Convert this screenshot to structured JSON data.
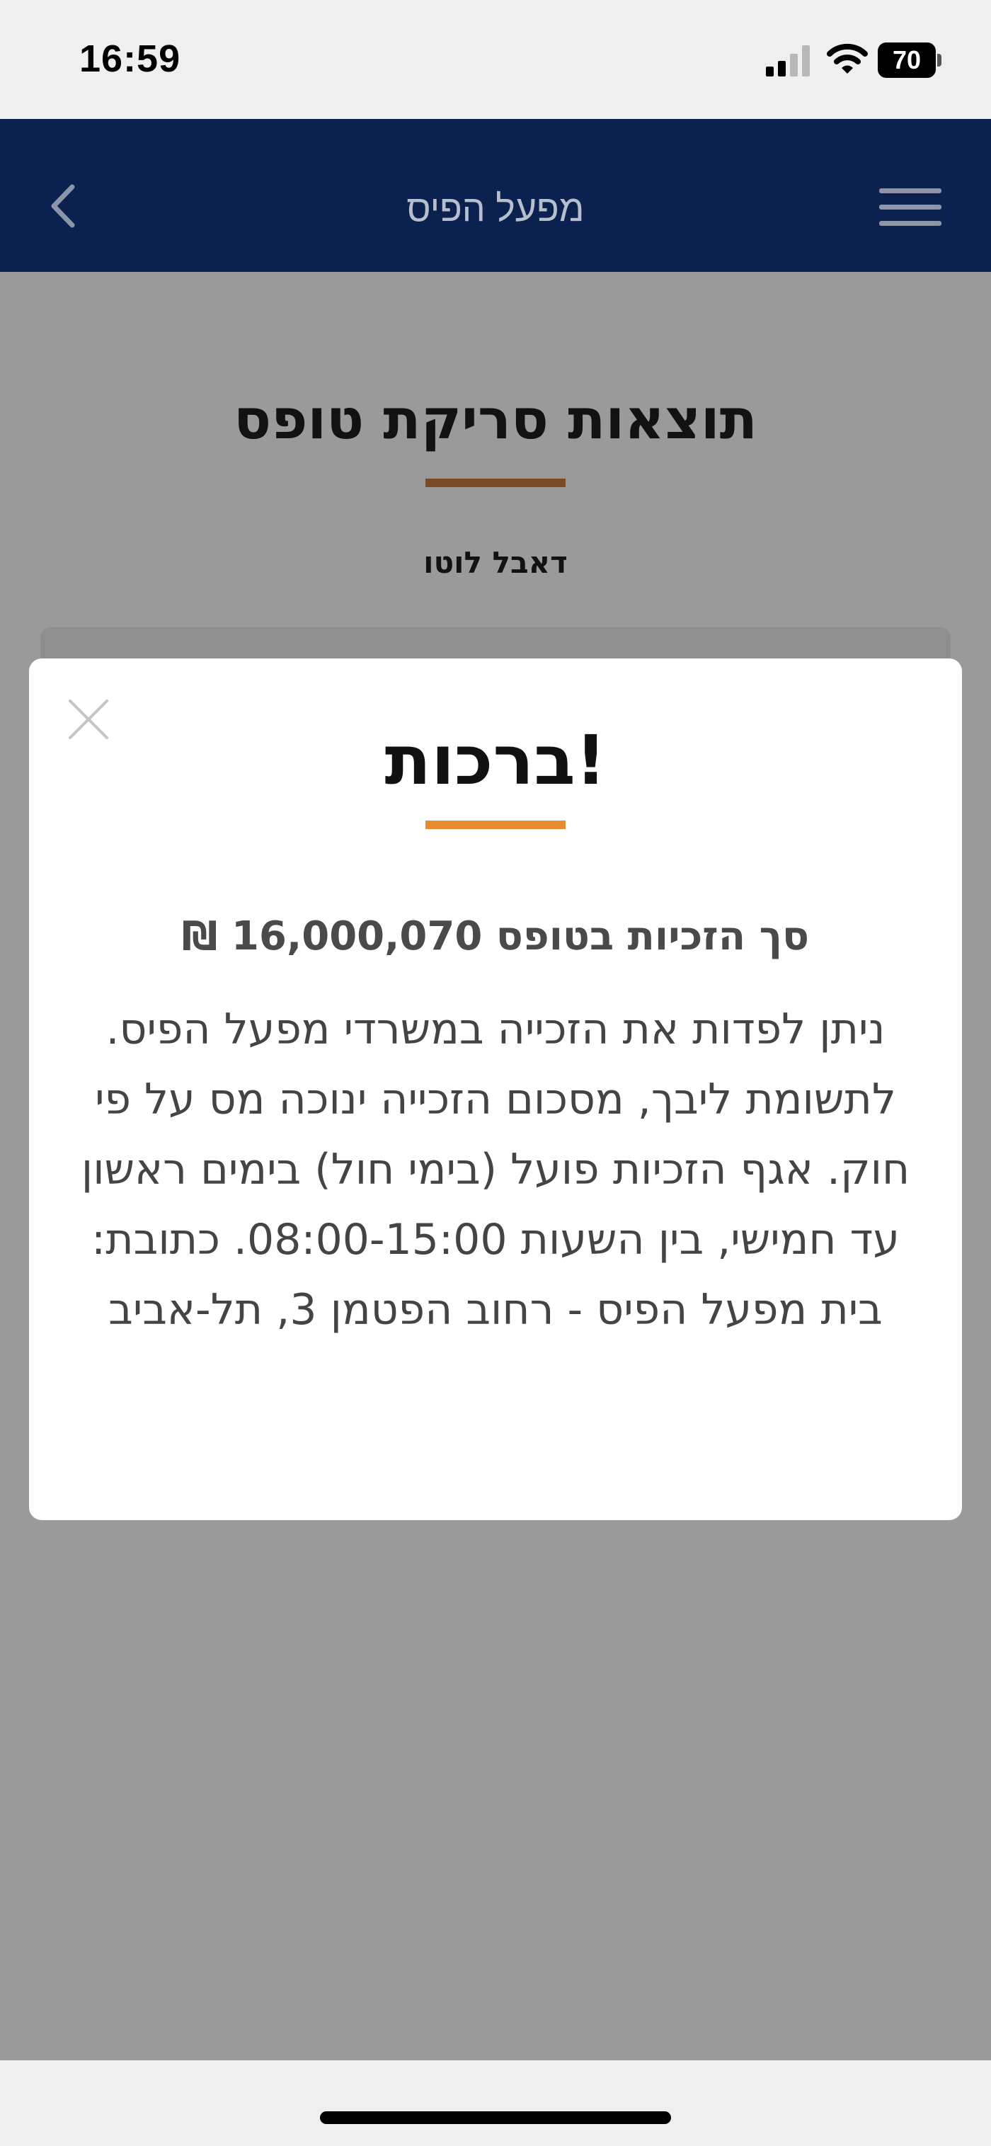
{
  "status_bar": {
    "time": "16:59",
    "battery_level": "70",
    "icons": [
      "signal-icon",
      "wifi-icon",
      "battery-icon"
    ]
  },
  "nav": {
    "title": "מפעל הפיס",
    "back_icon": "chevron-left-icon",
    "menu_icon": "hamburger-menu-icon"
  },
  "page": {
    "heading": "תוצאות סריקת טופס",
    "subheading": "דאבל לוטו"
  },
  "modal": {
    "title": "ברכות!",
    "subtitle": "סך הזכיות בטופס 16,000,070 ₪",
    "body": "ניתן לפדות את הזכייה במשרדי מפעל הפיס. לתשומת ליבך, מסכום הזכייה ינוכה מס על פי חוק. אגף הזכיות פועל (בימי חול) בימים ראשון עד חמישי, בין השעות 08:00-15:00. כתובת: בית מפעל הפיס - רחוב הפטמן 3, תל-אביב",
    "close_icon": "close-icon"
  },
  "colors": {
    "nav_background": "#0b2150",
    "accent": "#e88b2e",
    "overlay": "#9a9a9a"
  }
}
